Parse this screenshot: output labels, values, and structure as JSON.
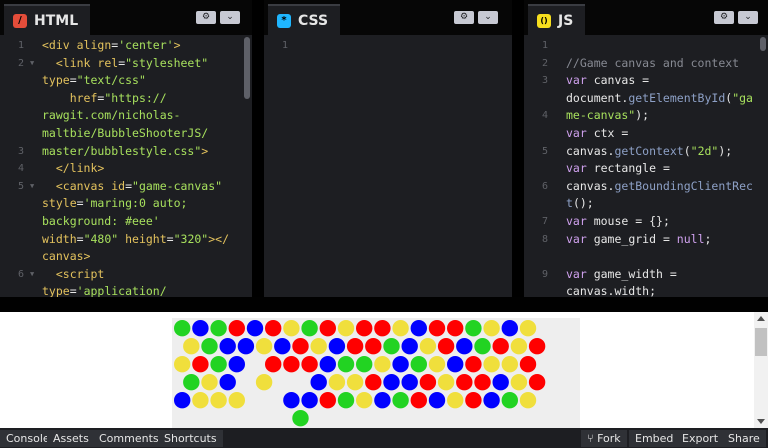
{
  "panels": {
    "html": {
      "label": "HTML",
      "icon": "slash-icon",
      "icon_glyph": "/",
      "color": "#e44d3a",
      "line_numbers": [
        "1",
        "2",
        "",
        "",
        "",
        "",
        "3",
        "4",
        "5",
        "",
        "",
        "",
        "",
        "6",
        ""
      ],
      "code": [
        [
          [
            "tag",
            "<div "
          ],
          [
            "attr",
            "align"
          ],
          [
            "var",
            "="
          ],
          [
            "str",
            "'center'"
          ],
          [
            "tag",
            ">"
          ]
        ],
        [
          [
            "var",
            "  "
          ],
          [
            "tag",
            "<link "
          ],
          [
            "attr",
            "rel"
          ],
          [
            "var",
            "="
          ],
          [
            "str",
            "\"stylesheet\""
          ]
        ],
        [
          [
            "attr",
            "type"
          ],
          [
            "var",
            "="
          ],
          [
            "str",
            "\"text/css\""
          ]
        ],
        [
          [
            "var",
            "    "
          ],
          [
            "attr",
            "href"
          ],
          [
            "var",
            "="
          ],
          [
            "str",
            "\"https://"
          ]
        ],
        [
          [
            "str",
            "rawgit.com/nicholas-"
          ]
        ],
        [
          [
            "str",
            "maltbie/BubbleShooterJS/"
          ]
        ],
        [
          [
            "str",
            "master/bubblestyle.css\""
          ],
          [
            "tag",
            ">"
          ]
        ],
        [
          [
            "var",
            "  "
          ],
          [
            "tag",
            "</link>"
          ]
        ],
        [
          [
            "var",
            "  "
          ],
          [
            "tag",
            "<canvas "
          ],
          [
            "attr",
            "id"
          ],
          [
            "var",
            "="
          ],
          [
            "str",
            "\"game-canvas\""
          ]
        ],
        [
          [
            "attr",
            "style"
          ],
          [
            "var",
            "="
          ],
          [
            "str",
            "'maring:0 auto;"
          ]
        ],
        [
          [
            "str",
            "background: #eee'"
          ]
        ],
        [
          [
            "attr",
            "width"
          ],
          [
            "var",
            "="
          ],
          [
            "str",
            "\"480\" "
          ],
          [
            "attr",
            "height"
          ],
          [
            "var",
            "="
          ],
          [
            "str",
            "\"320\""
          ],
          [
            "tag",
            "></"
          ]
        ],
        [
          [
            "tag",
            "canvas>"
          ]
        ],
        [
          [
            "var",
            "  "
          ],
          [
            "tag",
            "<script"
          ]
        ],
        [
          [
            "attr",
            "type"
          ],
          [
            "var",
            "="
          ],
          [
            "str",
            "'application/"
          ]
        ]
      ]
    },
    "css": {
      "label": "CSS",
      "icon": "asterisk-icon",
      "icon_glyph": "*",
      "color": "#1fb6ff",
      "line_numbers": [
        "1"
      ],
      "code": [
        []
      ]
    },
    "js": {
      "label": "JS",
      "icon": "braces-icon",
      "icon_glyph": "()",
      "color": "#f7df1e",
      "line_numbers": [
        "1",
        "2",
        "3",
        "",
        "4",
        "",
        "5",
        "",
        "6",
        "",
        "7",
        "8",
        "",
        "9",
        ""
      ],
      "code": [
        [],
        [
          [
            "cm",
            "//Game canvas and context"
          ]
        ],
        [
          [
            "kw",
            "var "
          ],
          [
            "var",
            "canvas ="
          ]
        ],
        [
          [
            "var",
            "document."
          ],
          [
            "fn",
            "getElementById"
          ],
          [
            "var",
            "("
          ],
          [
            "str2",
            "\"ga"
          ]
        ],
        [
          [
            "str2",
            "me-canvas\""
          ],
          [
            "var",
            ");"
          ]
        ],
        [
          [
            "kw",
            "var "
          ],
          [
            "var",
            "ctx ="
          ]
        ],
        [
          [
            "var",
            "canvas."
          ],
          [
            "fn",
            "getContext"
          ],
          [
            "var",
            "("
          ],
          [
            "str2",
            "\"2d\""
          ],
          [
            "var",
            ");"
          ]
        ],
        [
          [
            "kw",
            "var "
          ],
          [
            "var",
            "rectangle ="
          ]
        ],
        [
          [
            "var",
            "canvas."
          ],
          [
            "fn",
            "getBoundingClientRec"
          ]
        ],
        [
          [
            "fn",
            "t"
          ],
          [
            "var",
            "();"
          ]
        ],
        [
          [
            "kw",
            "var "
          ],
          [
            "var",
            "mouse = {};"
          ]
        ],
        [
          [
            "kw",
            "var "
          ],
          [
            "var",
            "game_grid = "
          ],
          [
            "kw",
            "null"
          ],
          [
            "var",
            ";"
          ]
        ],
        [],
        [
          [
            "kw",
            "var "
          ],
          [
            "var",
            "game_width ="
          ]
        ],
        [
          [
            "var",
            "canvas.width;"
          ]
        ]
      ]
    }
  },
  "colors": {
    "red": "#ff0000",
    "blue": "#0000ff",
    "green": "#22d322",
    "yellow": "#f0df3c"
  },
  "bubbles": {
    "rows": [
      [
        "green",
        "blue",
        "green",
        "red",
        "blue",
        "red",
        "yellow",
        "green",
        "red",
        "yellow",
        "red",
        "red",
        "yellow",
        "blue",
        "red",
        "red",
        "green",
        "yellow",
        "blue",
        "yellow"
      ],
      [
        "yellow",
        "green",
        "blue",
        "blue",
        "yellow",
        "blue",
        "red",
        "yellow",
        "blue",
        "red",
        "red",
        "green",
        "blue",
        "yellow",
        "red",
        "blue",
        "green",
        "red",
        "yellow",
        "red"
      ],
      [
        "yellow",
        "red",
        "green",
        "blue",
        "",
        "red",
        "red",
        "red",
        "blue",
        "green",
        "green",
        "yellow",
        "blue",
        "green",
        "yellow",
        "blue",
        "red",
        "yellow",
        "yellow",
        "red"
      ],
      [
        "green",
        "yellow",
        "blue",
        "",
        "yellow",
        "",
        "",
        "blue",
        "yellow",
        "yellow",
        "red",
        "blue",
        "blue",
        "red",
        "yellow",
        "red",
        "red",
        "blue",
        "yellow",
        "red"
      ],
      [
        "blue",
        "yellow",
        "yellow",
        "yellow",
        "",
        "",
        "blue",
        "blue",
        "red",
        "green",
        "yellow",
        "blue",
        "green",
        "red",
        "blue",
        "yellow",
        "red",
        "blue",
        "green",
        "yellow"
      ],
      [
        "",
        "",
        "",
        "",
        "",
        "",
        "green"
      ]
    ]
  },
  "bottom_bar": {
    "left": [
      "Console",
      "Assets",
      "Comments",
      "Shortcuts"
    ],
    "right": [
      "Fork",
      "Embed",
      "Export",
      "Share"
    ]
  },
  "controls": {
    "settings_icon": "gear-icon",
    "collapse_icon": "chevron-down-icon"
  }
}
